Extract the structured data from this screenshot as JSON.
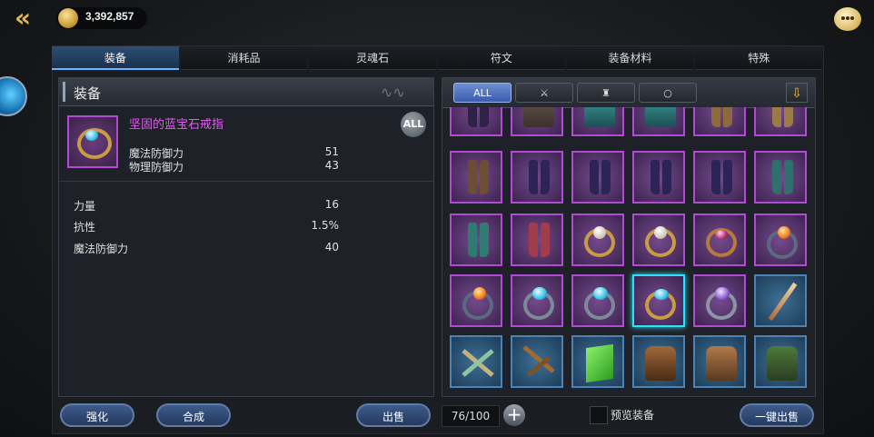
{
  "header": {
    "gold_amount": "3,392,857",
    "back_icon": "double-chevron-left-icon",
    "chat_icon": "chat-bubble-icon"
  },
  "tabs": [
    {
      "label": "装备",
      "active": true
    },
    {
      "label": "消耗品",
      "active": false
    },
    {
      "label": "灵魂石",
      "active": false
    },
    {
      "label": "符文",
      "active": false
    },
    {
      "label": "装备材料",
      "active": false
    },
    {
      "label": "特殊",
      "active": false
    }
  ],
  "detail": {
    "panel_title": "装备",
    "item_name": "坚固的蓝宝石戒指",
    "all_label": "ALL",
    "base_stats": [
      {
        "name": "魔法防御力",
        "value": "51"
      },
      {
        "name": "物理防御力",
        "value": "43"
      }
    ],
    "extra_stats": [
      {
        "name": "力量",
        "value": "16"
      },
      {
        "name": "抗性",
        "value": "1.5%"
      },
      {
        "name": "魔法防御力",
        "value": "40"
      }
    ]
  },
  "filters": {
    "all_label": "ALL",
    "icons": [
      "sword-icon",
      "armor-icon",
      "ring-icon"
    ],
    "sort_icon": "sort-arrow-down-icon"
  },
  "inventory": {
    "count": "76/100",
    "rows": [
      [
        "boots-purple",
        "gauntlet-bronze",
        "gauntlet-teal",
        "gauntlet-teal",
        "boots-bronze",
        "boots-bronze"
      ],
      [
        "boots-brown",
        "boots-purple",
        "boots-purple",
        "boots-purple",
        "boots-purple",
        "boots-teal"
      ],
      [
        "boots-teal",
        "boots-red",
        "ring-pearl",
        "ring-pearl",
        "ring-ruby",
        "ring-fire"
      ],
      [
        "ring-fire",
        "ring-sapphire",
        "ring-sapphire",
        "ring-sapphire",
        "ring-amethyst",
        "dagger"
      ],
      [
        "crossed-swords",
        "crossbow",
        "spellbook",
        "armor-leather",
        "armor-leather",
        "armor-green"
      ]
    ],
    "selected_index": "3-3"
  },
  "buttons": {
    "enhance": "强化",
    "combine": "合成",
    "sell": "出售",
    "preview": "预览装备",
    "sell_all": "一键出售"
  },
  "colors": {
    "epic": "#b24ad6",
    "rare": "#4c82b4",
    "accent": "#2fe0ff",
    "gold": "#e2b85a"
  }
}
